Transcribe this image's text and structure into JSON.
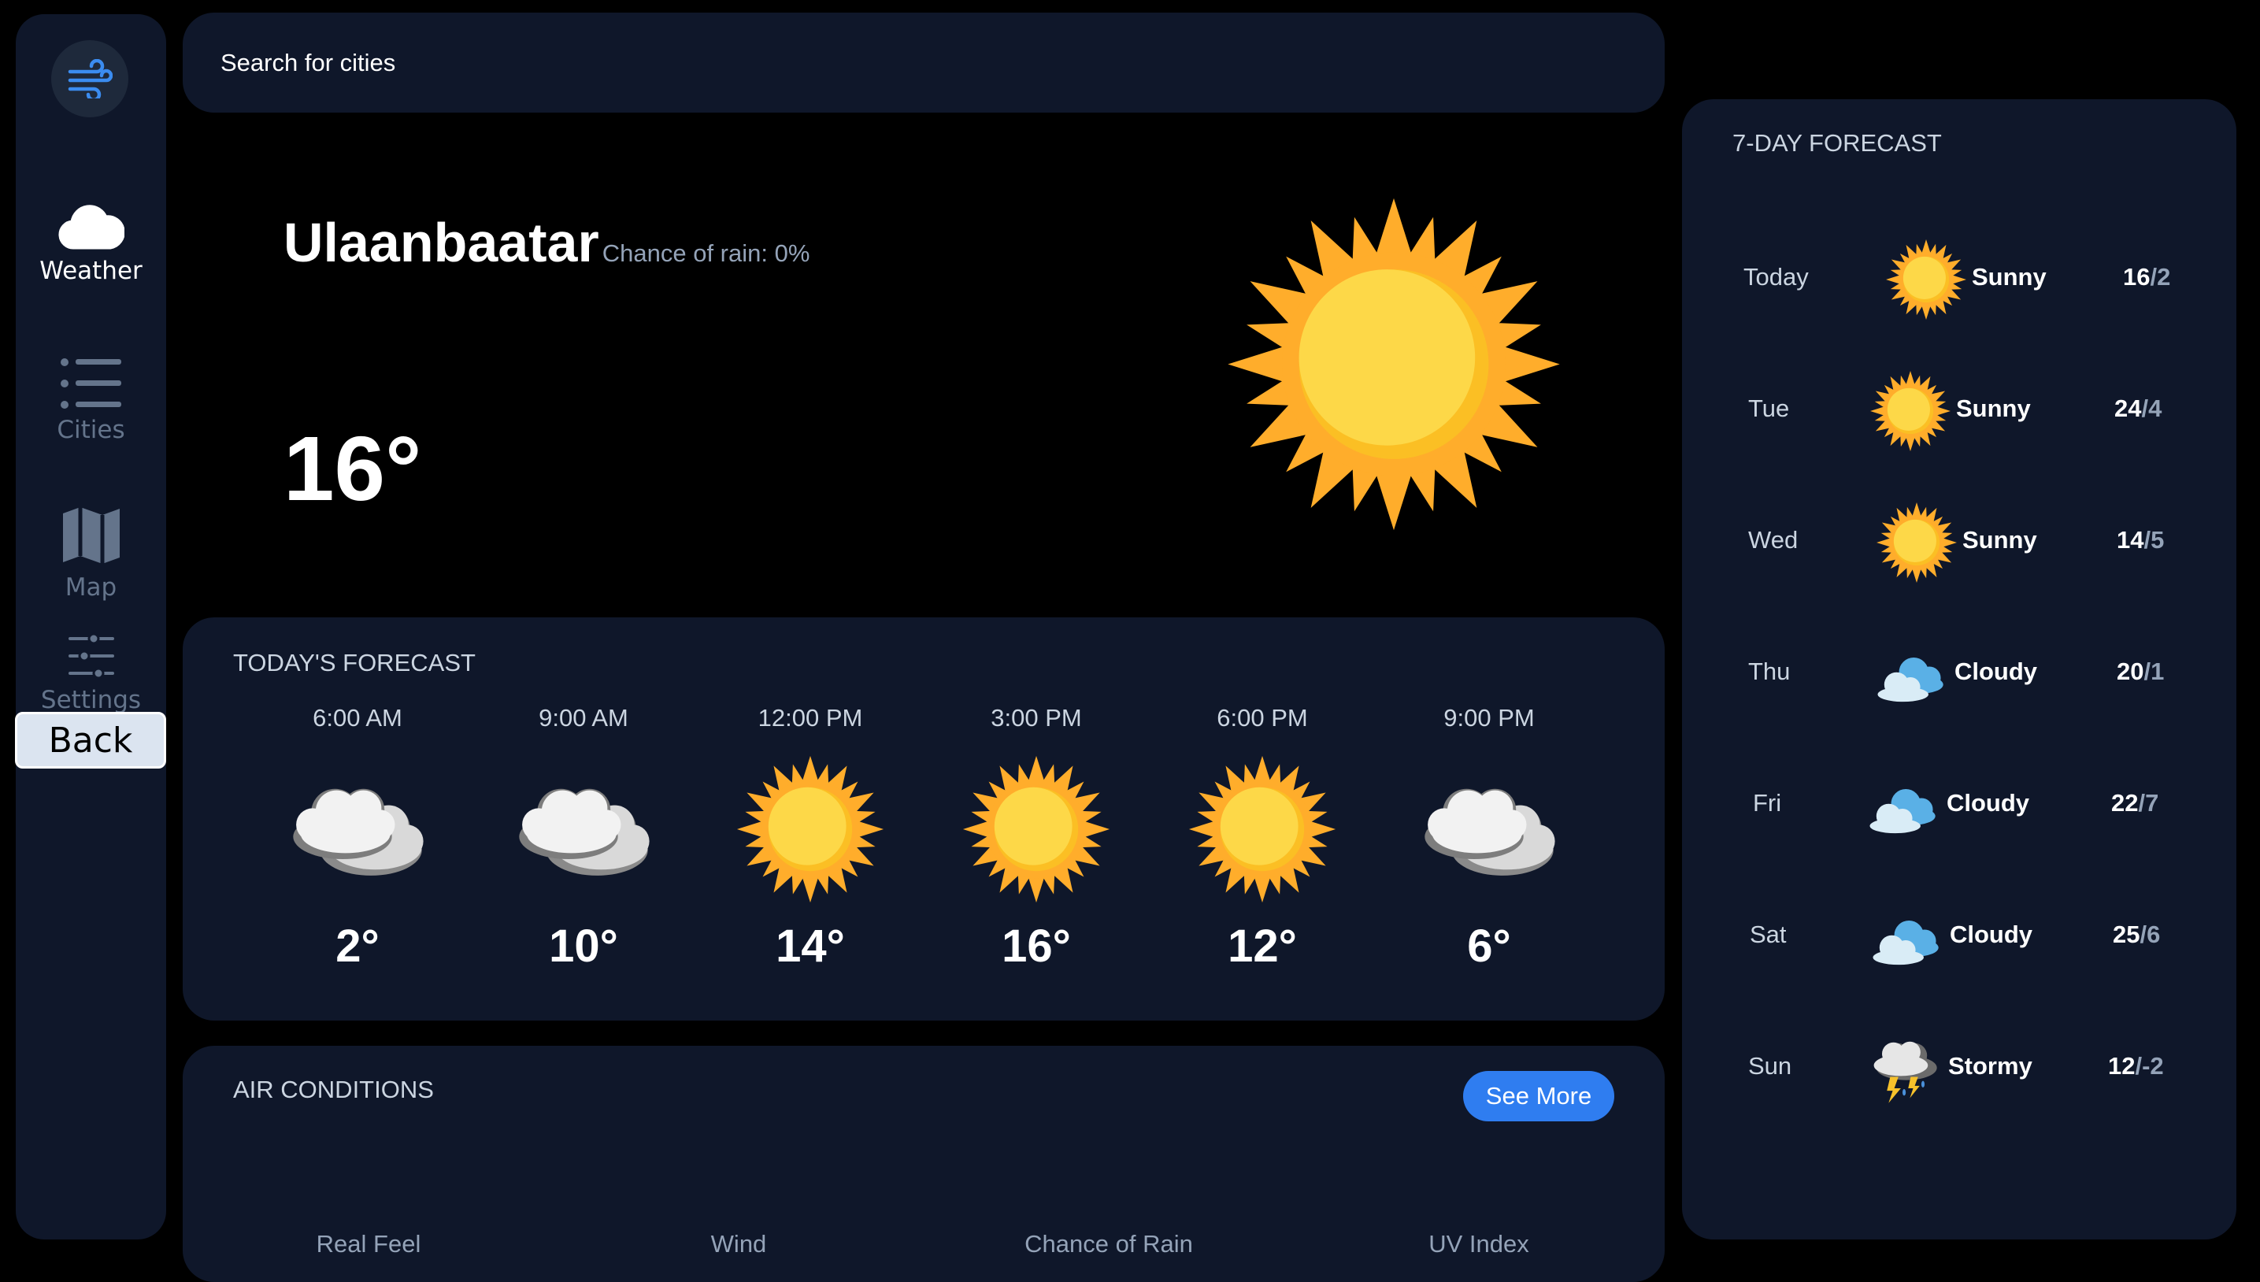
{
  "sidebar": {
    "logo_icon": "wind-icon",
    "items": [
      {
        "label": "Weather",
        "icon": "cloud-icon",
        "active": true
      },
      {
        "label": "Cities",
        "icon": "list-icon",
        "active": false
      },
      {
        "label": "Map",
        "icon": "map-icon",
        "active": false
      },
      {
        "label": "Settings",
        "icon": "sliders-icon",
        "active": false
      }
    ],
    "back_label": "Back"
  },
  "search": {
    "placeholder": "Search for cities"
  },
  "current": {
    "city": "Ulaanbaatar",
    "rain_chance": "Chance of rain: 0%",
    "temperature": "16°",
    "icon": "sun-icon"
  },
  "today_forecast": {
    "title": "TODAY'S FORECAST",
    "hours": [
      {
        "time": "6:00 AM",
        "icon": "cloud-icon",
        "temp": "2°"
      },
      {
        "time": "9:00 AM",
        "icon": "cloud-icon",
        "temp": "10°"
      },
      {
        "time": "12:00 PM",
        "icon": "sun-icon",
        "temp": "14°"
      },
      {
        "time": "3:00 PM",
        "icon": "sun-icon",
        "temp": "16°"
      },
      {
        "time": "6:00 PM",
        "icon": "sun-icon",
        "temp": "12°"
      },
      {
        "time": "9:00 PM",
        "icon": "cloud-icon",
        "temp": "6°"
      }
    ]
  },
  "air_conditions": {
    "title": "AIR CONDITIONS",
    "see_more": "See More",
    "columns": [
      "Real Feel",
      "Wind",
      "Chance of Rain",
      "UV Index"
    ]
  },
  "week_forecast": {
    "title": "7-DAY FORECAST",
    "days": [
      {
        "day": "Today",
        "icon": "sun-icon",
        "condition": "Sunny",
        "high": "16",
        "low": "/2"
      },
      {
        "day": "Tue",
        "icon": "sun-icon",
        "condition": "Sunny",
        "high": "24",
        "low": "/4"
      },
      {
        "day": "Wed",
        "icon": "sun-icon",
        "condition": "Sunny",
        "high": "14",
        "low": "/5"
      },
      {
        "day": "Thu",
        "icon": "cloud-icon",
        "condition": "Cloudy",
        "high": "20",
        "low": "/1"
      },
      {
        "day": "Fri",
        "icon": "cloud-icon",
        "condition": "Cloudy",
        "high": "22",
        "low": "/7"
      },
      {
        "day": "Sat",
        "icon": "cloud-icon",
        "condition": "Cloudy",
        "high": "25",
        "low": "/6"
      },
      {
        "day": "Sun",
        "icon": "storm-icon",
        "condition": "Stormy",
        "high": "12",
        "low": "/-2"
      }
    ]
  },
  "colors": {
    "panel": "#0f172a",
    "accent": "#2f7df0",
    "muted": "#64748b",
    "sun": "#fbbf24"
  }
}
